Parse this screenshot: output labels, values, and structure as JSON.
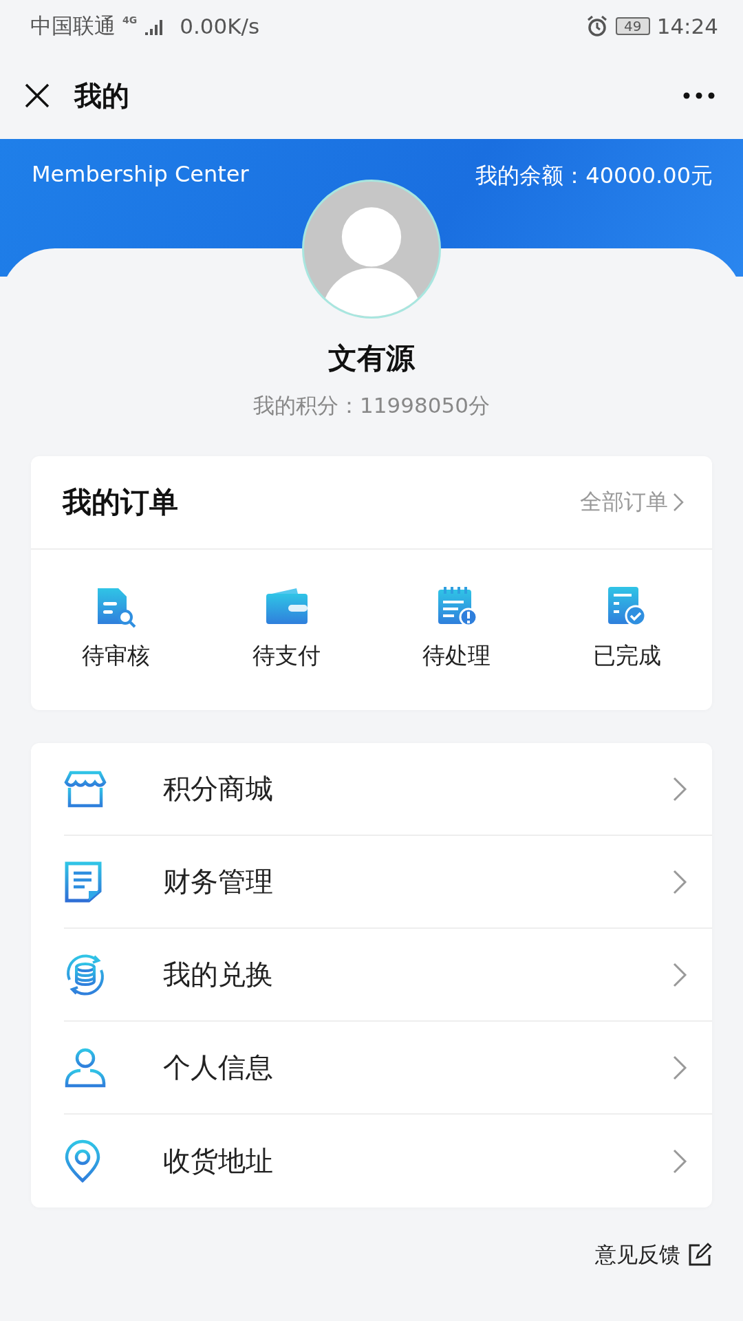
{
  "status_bar": {
    "carrier": "中国联通",
    "network": "4G",
    "speed": "0.00K/s",
    "battery": "49",
    "time": "14:24"
  },
  "nav": {
    "title": "我的"
  },
  "banner": {
    "title": "Membership Center",
    "balance": "我的余额：40000.00元"
  },
  "profile": {
    "name": "文有源",
    "points": "我的积分：11998050分"
  },
  "orders": {
    "title": "我的订单",
    "all_link": "全部订单",
    "items": [
      {
        "kind": "review",
        "label": "待审核"
      },
      {
        "kind": "pay",
        "label": "待支付"
      },
      {
        "kind": "process",
        "label": "待处理"
      },
      {
        "kind": "done",
        "label": "已完成"
      }
    ]
  },
  "menu": [
    {
      "kind": "shop",
      "label": "积分商城"
    },
    {
      "kind": "finance",
      "label": "财务管理"
    },
    {
      "kind": "exchange",
      "label": "我的兑换"
    },
    {
      "kind": "person",
      "label": "个人信息"
    },
    {
      "kind": "location",
      "label": "收货地址"
    }
  ],
  "feedback": "意见反馈"
}
